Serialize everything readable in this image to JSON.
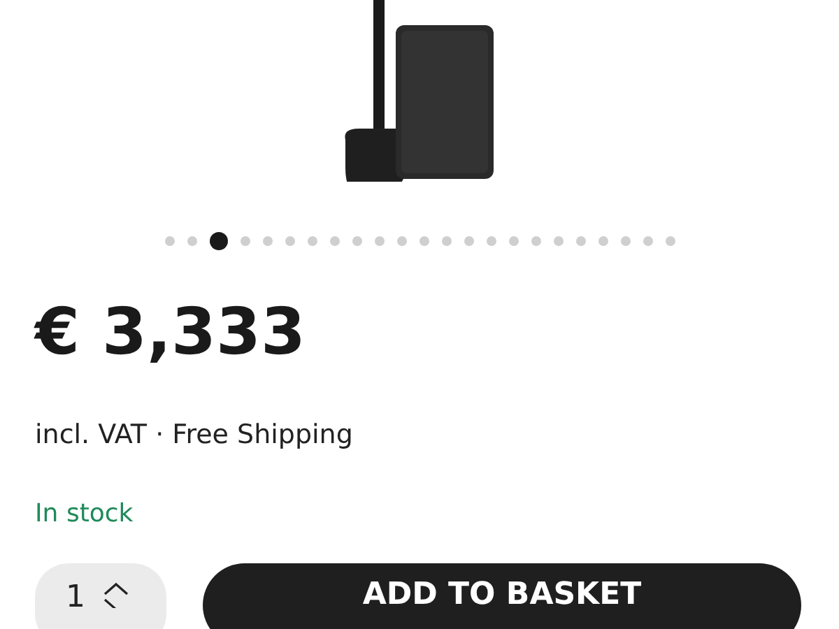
{
  "gallery": {
    "slides": [
      {
        "selected": false
      },
      {
        "selected": false
      },
      {
        "selected": true
      },
      {
        "selected": false
      },
      {
        "selected": false
      },
      {
        "selected": false
      },
      {
        "selected": false
      },
      {
        "selected": false
      },
      {
        "selected": false
      },
      {
        "selected": false
      },
      {
        "selected": false
      },
      {
        "selected": false
      },
      {
        "selected": false
      },
      {
        "selected": false
      },
      {
        "selected": false
      },
      {
        "selected": false
      },
      {
        "selected": false
      },
      {
        "selected": false
      },
      {
        "selected": false
      },
      {
        "selected": false
      },
      {
        "selected": false
      },
      {
        "selected": false
      },
      {
        "selected": false
      }
    ]
  },
  "price": "€ 3,333",
  "price_note": "incl. VAT · Free Shipping",
  "availability": "In stock",
  "quantity": {
    "value": "1"
  },
  "add_button": "ADD TO BASKET"
}
